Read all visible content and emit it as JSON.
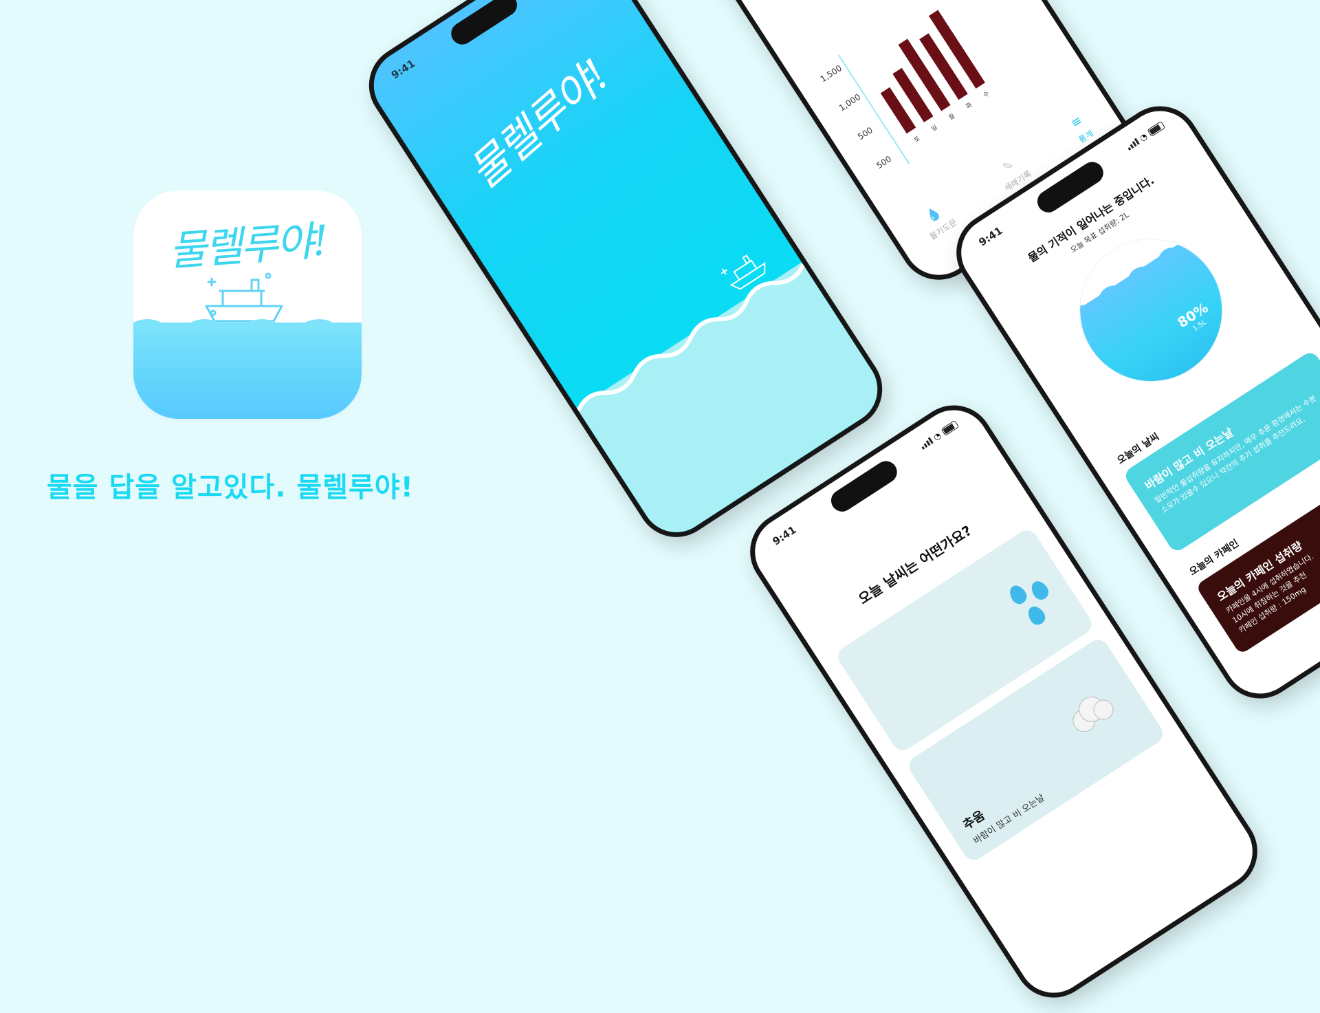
{
  "tagline": "물을 답을 알고있다. 물렐루야!",
  "app_name_script": "물렐루야!",
  "colors": {
    "background": "#e3fbfd",
    "accent": "#1ad9f2",
    "water": "#5ec9ff",
    "caffeine": "#3a0d0d"
  },
  "splash": {
    "time": "9:41",
    "script": "물렐루야!"
  },
  "stats_phone": {
    "y_ticks": [
      "1,500",
      "1,000",
      "500",
      "500"
    ],
    "bars": [
      {
        "label": "토",
        "value": 1000
      },
      {
        "label": "일",
        "value": 1200
      },
      {
        "label": "월",
        "value": 1650
      },
      {
        "label": "화",
        "value": 1500
      },
      {
        "label": "수",
        "value": 1800
      }
    ],
    "tabs": {
      "water": "물기도문",
      "record": "세례기록",
      "stats": "통계"
    }
  },
  "main_phone": {
    "time": "9:41",
    "title": "물의 기적이 일어나는 중입니다.",
    "goal": "오늘 목표 섭취량: 2L",
    "percent": "80%",
    "amount": "1.5L",
    "weather_section": "오늘의 날씨",
    "weather_title": "바람이 많고 비 오는날",
    "weather_body": "일반적인 물섭취량을 유지하지만, 매우 추운 환경에서는 수분 소모가 있을수 있으니 약간의 추가 섭취를 추천드려요.",
    "caffeine_section": "오늘의 카페인",
    "caffeine_title": "오늘의 카페인 섭취량",
    "caffeine_body_1": "카페인을 4시에 섭취하였습니다.",
    "caffeine_body_2": "10시에 취침하는 것을 추천",
    "caffeine_body_3": "카페인 섭취량 : 150mg"
  },
  "weather_phone": {
    "time": "9:41",
    "question": "오늘 날씨는 어떤가요?",
    "option_cold": "추움",
    "option_cold_sub": "바람이 많고 비 오는날"
  }
}
